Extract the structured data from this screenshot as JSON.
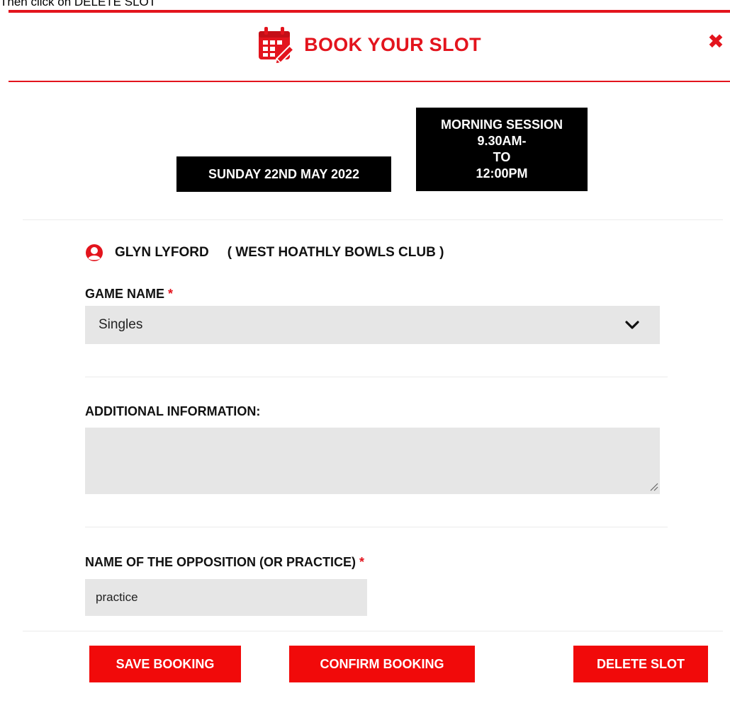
{
  "instruction": "Then click on DELETE SLOT",
  "header": {
    "title": "BOOK YOUR SLOT",
    "close_symbol": "✖",
    "icon": "calendar-edit-icon"
  },
  "slot": {
    "date": "SUNDAY 22ND MAY 2022",
    "session": {
      "line1": "MORNING SESSION",
      "line2": "9.30AM-",
      "line3": "TO",
      "line4": "12:00PM"
    }
  },
  "user": {
    "name": "GLYN LYFORD",
    "club": "( WEST HOATHLY BOWLS CLUB )",
    "icon": "user-circle-icon"
  },
  "form": {
    "game_name_label": "GAME NAME",
    "required_mark": "*",
    "game_name_value": "Singles",
    "additional_info_label": "ADDITIONAL INFORMATION:",
    "additional_info_value": "",
    "opposition_label": "NAME OF THE OPPOSITION (OR PRACTICE)",
    "opposition_value": "practice"
  },
  "buttons": {
    "save": "SAVE BOOKING",
    "confirm": "CONFIRM BOOKING",
    "delete": "DELETE SLOT"
  },
  "colors": {
    "accent": "#e3141d",
    "button": "#f10a0a",
    "input_bg": "#e6e6e6",
    "black_box": "#000000"
  }
}
